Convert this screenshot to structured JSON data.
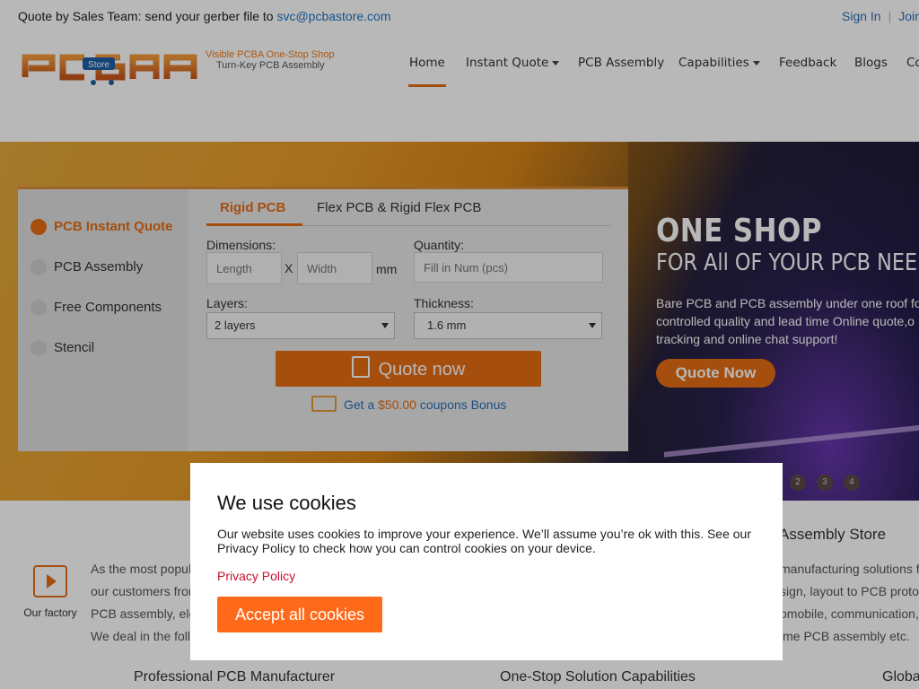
{
  "topbar": {
    "quote_prefix": "Quote by Sales Team: send your gerber file to ",
    "email": "svc@pcbastore.com",
    "sign_in": "Sign In",
    "join": "Join"
  },
  "brand": {
    "tagline1": "Visible PCBA One-Stop Shop",
    "tagline2": "Turn-Key PCB Assembly",
    "logo_badge": "Store"
  },
  "nav": {
    "home": "Home",
    "instant_quote": "Instant Quote",
    "pcb_assembly": "PCB Assembly",
    "capabilities": "Capabilities",
    "feedback": "Feedback",
    "blogs": "Blogs",
    "contact": "Co"
  },
  "side_menu": {
    "items": [
      {
        "label": "PCB Instant Quote"
      },
      {
        "label": "PCB Assembly"
      },
      {
        "label": "Free Components"
      },
      {
        "label": "Stencil"
      }
    ]
  },
  "quote": {
    "tabs": [
      {
        "label": "Rigid PCB"
      },
      {
        "label": "Flex PCB & Rigid Flex PCB"
      }
    ],
    "dimensions_label": "Dimensions:",
    "length_placeholder": "Length",
    "times": "X",
    "width_placeholder": "Width",
    "unit": "mm",
    "quantity_label": "Quantity:",
    "quantity_placeholder": "Fill in Num (pcs)",
    "layers_label": "Layers:",
    "layers_value": "2 layers",
    "thickness_label": "Thickness:",
    "thickness_value": "1.6 mm",
    "quote_button": "Quote now",
    "coupon_prefix": "Get a ",
    "coupon_amount": "$50.00",
    "coupon_suffix": " coupons Bonus"
  },
  "hero": {
    "title": "ONE SHOP",
    "subtitle": "FOR All OF YOUR PCB NEE",
    "desc1": "Bare PCB and PCB assembly under one roof fo",
    "desc2": "controlled quality and lead time Online quote,o",
    "desc3": "tracking and online chat support!",
    "button": "Quote Now",
    "dots": [
      "2",
      "3",
      "4"
    ]
  },
  "about": {
    "factory_label": "Our factory",
    "line1": "As the most popul",
    "line2": "our customers from",
    "line3": "PCB assembly, ele",
    "line4": "We deal in the foll",
    "store_title": "Assembly Store",
    "store1": "manufacturing solutions f",
    "store2": "sign, layout to PCB proto",
    "store3": "omobile, communication,",
    "store4": "ime PCB assembly etc.",
    "feature1": "Professional PCB Manufacturer",
    "feature2": "One-Stop Solution Capabilities",
    "feature3": "Globa"
  },
  "cookie": {
    "title": "We use cookies",
    "text": "Our website uses cookies to improve your experience. We’ll assume you’re ok with this. See our Privacy Policy to check how you can control cookies on your device.",
    "privacy_link": "Privacy Policy",
    "accept": "Accept all cookies"
  },
  "colors": {
    "accent": "#e56c14",
    "link": "#2a6fb5",
    "privacy": "#c8102e"
  }
}
